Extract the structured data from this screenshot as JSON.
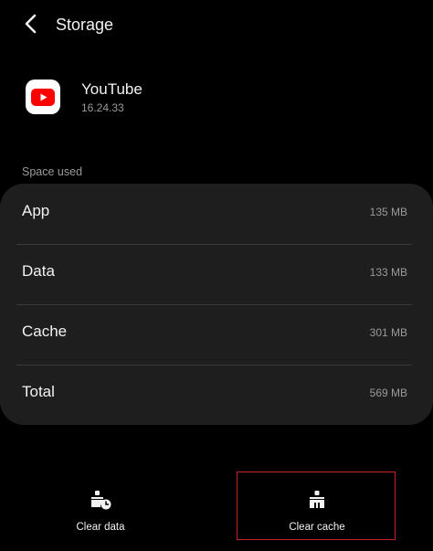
{
  "header": {
    "title": "Storage",
    "back_icon": "chevron-left-icon"
  },
  "app": {
    "name": "YouTube",
    "version": "16.24.33",
    "icon": "youtube-icon",
    "icon_color": "#ff0000"
  },
  "storage": {
    "section_label": "Space used",
    "rows": [
      {
        "label": "App",
        "value": "135 MB"
      },
      {
        "label": "Data",
        "value": "133 MB"
      },
      {
        "label": "Cache",
        "value": "301 MB"
      },
      {
        "label": "Total",
        "value": "569 MB"
      }
    ]
  },
  "actions": {
    "clear_data_label": "Clear data",
    "clear_data_icon": "clear-data-icon",
    "clear_cache_label": "Clear cache",
    "clear_cache_icon": "broom-icon",
    "highlight_color": "#c8202a"
  }
}
